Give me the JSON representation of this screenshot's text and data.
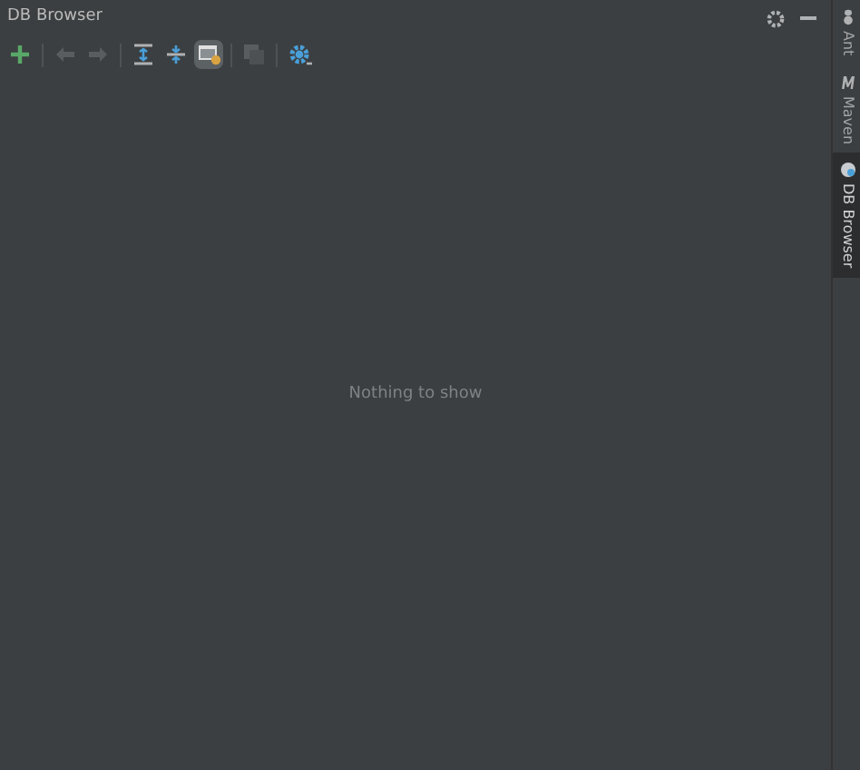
{
  "window": {
    "title": "DB Browser"
  },
  "toolbar": [
    {
      "kind": "add",
      "disabled": false,
      "selected": false
    },
    {
      "kind": "back",
      "disabled": true,
      "selected": false
    },
    {
      "kind": "forward",
      "disabled": true,
      "selected": false
    },
    {
      "kind": "expand",
      "disabled": false,
      "selected": false
    },
    {
      "kind": "collapse",
      "disabled": false,
      "selected": false
    },
    {
      "kind": "filter",
      "disabled": false,
      "selected": true
    },
    {
      "kind": "copy",
      "disabled": true,
      "selected": false
    },
    {
      "kind": "settings",
      "disabled": false,
      "selected": false
    }
  ],
  "empty_text": "Nothing to show",
  "side_tabs": [
    {
      "label": "Ant",
      "kind": "ant",
      "selected": false
    },
    {
      "label": "Maven",
      "kind": "maven",
      "selected": false
    },
    {
      "label": "DB Browser",
      "kind": "db",
      "selected": true
    }
  ]
}
